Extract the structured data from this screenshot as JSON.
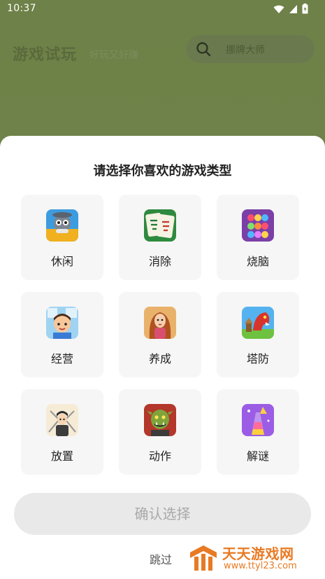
{
  "status_bar": {
    "time": "10:37"
  },
  "background_page": {
    "title": "游戏试玩",
    "subtitle": "好玩又好赚",
    "search": {
      "placeholder": "挪牌大师"
    }
  },
  "sheet": {
    "title": "请选择你喜欢的游戏类型",
    "categories": [
      {
        "label": "休闲",
        "icon": "casual-game-icon"
      },
      {
        "label": "消除",
        "icon": "mahjong-tile-icon"
      },
      {
        "label": "烧脑",
        "icon": "puzzle-color-sort-icon"
      },
      {
        "label": "经营",
        "icon": "management-cartoon-boy-icon"
      },
      {
        "label": "养成",
        "icon": "raising-character-girl-icon"
      },
      {
        "label": "塔防",
        "icon": "tower-defense-dragon-icon"
      },
      {
        "label": "放置",
        "icon": "idle-swordsman-icon"
      },
      {
        "label": "动作",
        "icon": "action-orc-warrior-icon"
      },
      {
        "label": "解谜",
        "icon": "mystery-liquid-sort-icon"
      }
    ],
    "confirm_label": "确认选择",
    "skip_label": "跳过"
  },
  "watermark": {
    "name": "天天游戏网",
    "url": "www.ttyl23.com"
  },
  "colors": {
    "background_overlay": "#6f8049",
    "sheet_bg": "#ffffff",
    "card_bg": "#f6f6f6",
    "button_disabled_bg": "#e9e9e9",
    "button_disabled_text": "#a9a9a9",
    "watermark": "#e87a23"
  }
}
